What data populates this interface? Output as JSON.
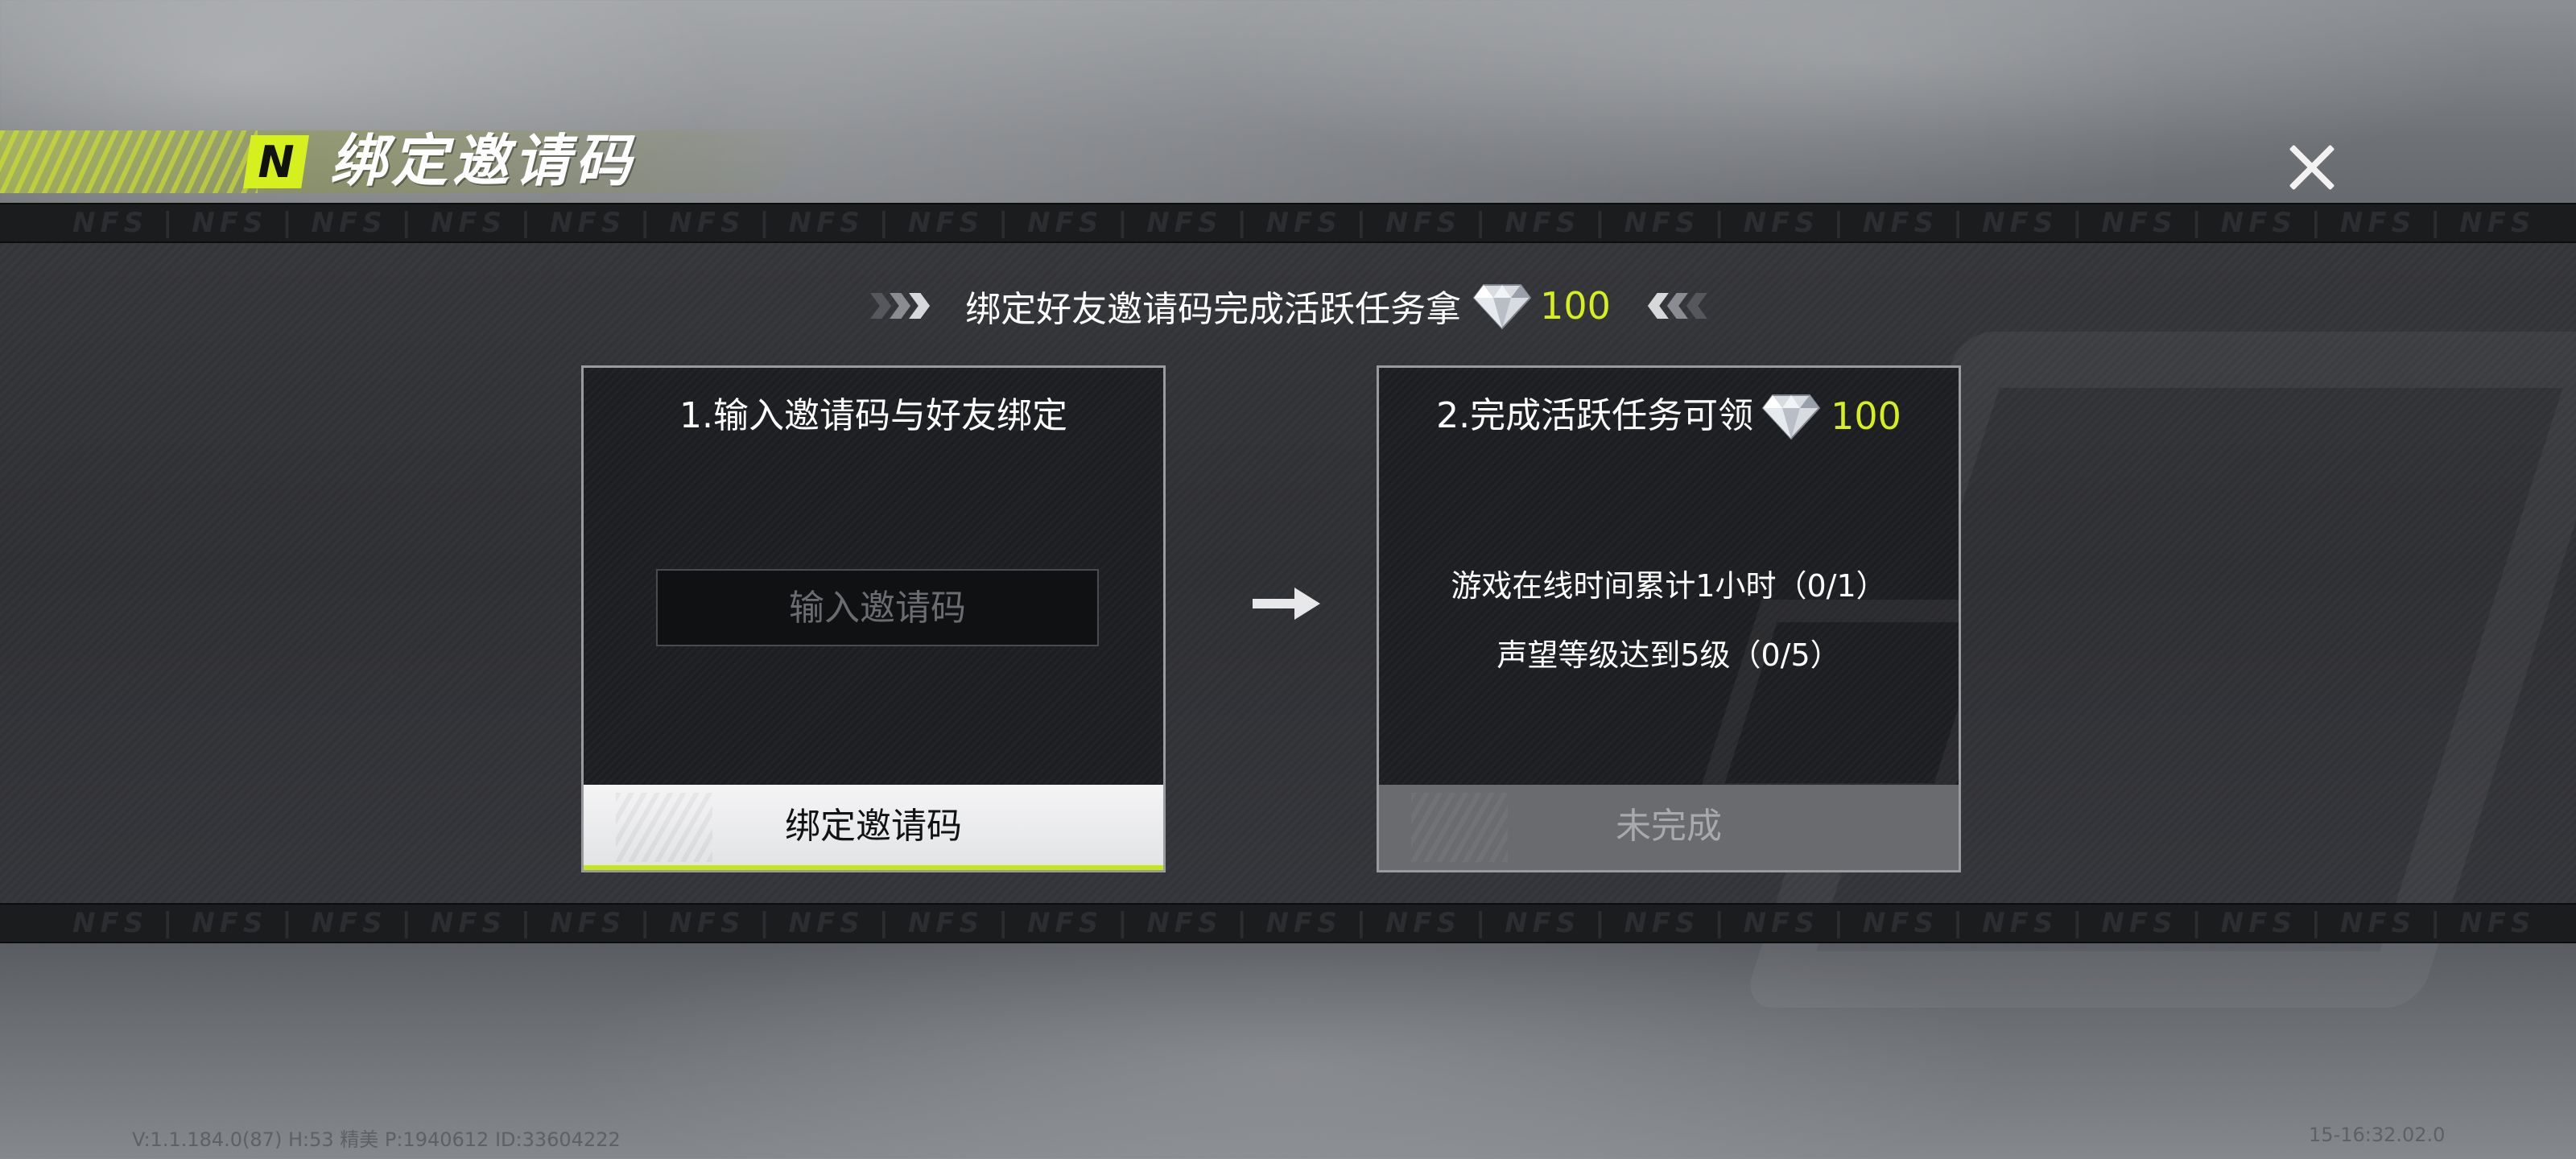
{
  "header": {
    "logo_letter": "N",
    "title": "绑定邀请码"
  },
  "strip": {
    "pattern_text": "NFS | NFS | NFS | NFS | NFS | NFS | NFS | NFS | NFS | NFS | NFS | NFS | NFS | NFS | NFS | NFS | NFS | NFS | NFS | NFS | NFS"
  },
  "subtitle": {
    "text": "绑定好友邀请码完成活跃任务拿",
    "reward_icon": "diamond-icon",
    "reward_amount": "100"
  },
  "step1": {
    "title": "1.输入邀请码与好友绑定",
    "input_placeholder": "输入邀请码",
    "input_value": "",
    "button_label": "绑定邀请码"
  },
  "step2": {
    "title": "2.完成活跃任务可领",
    "reward_icon": "diamond-icon",
    "reward_amount": "100",
    "tasks": [
      "游戏在线时间累计1小时（0/1）",
      "声望等级达到5级（0/5）"
    ],
    "button_label": "未完成"
  },
  "footer": {
    "left": "V:1.1.184.0(87) H:53 精美 P:1940612 ID:33604222",
    "right": "15-16:32.02.0"
  },
  "colors": {
    "accent": "#d6ef1f",
    "panel": "#2e2f33",
    "card_bg": "#1d1e21",
    "card_border": "#9a9b9e"
  }
}
